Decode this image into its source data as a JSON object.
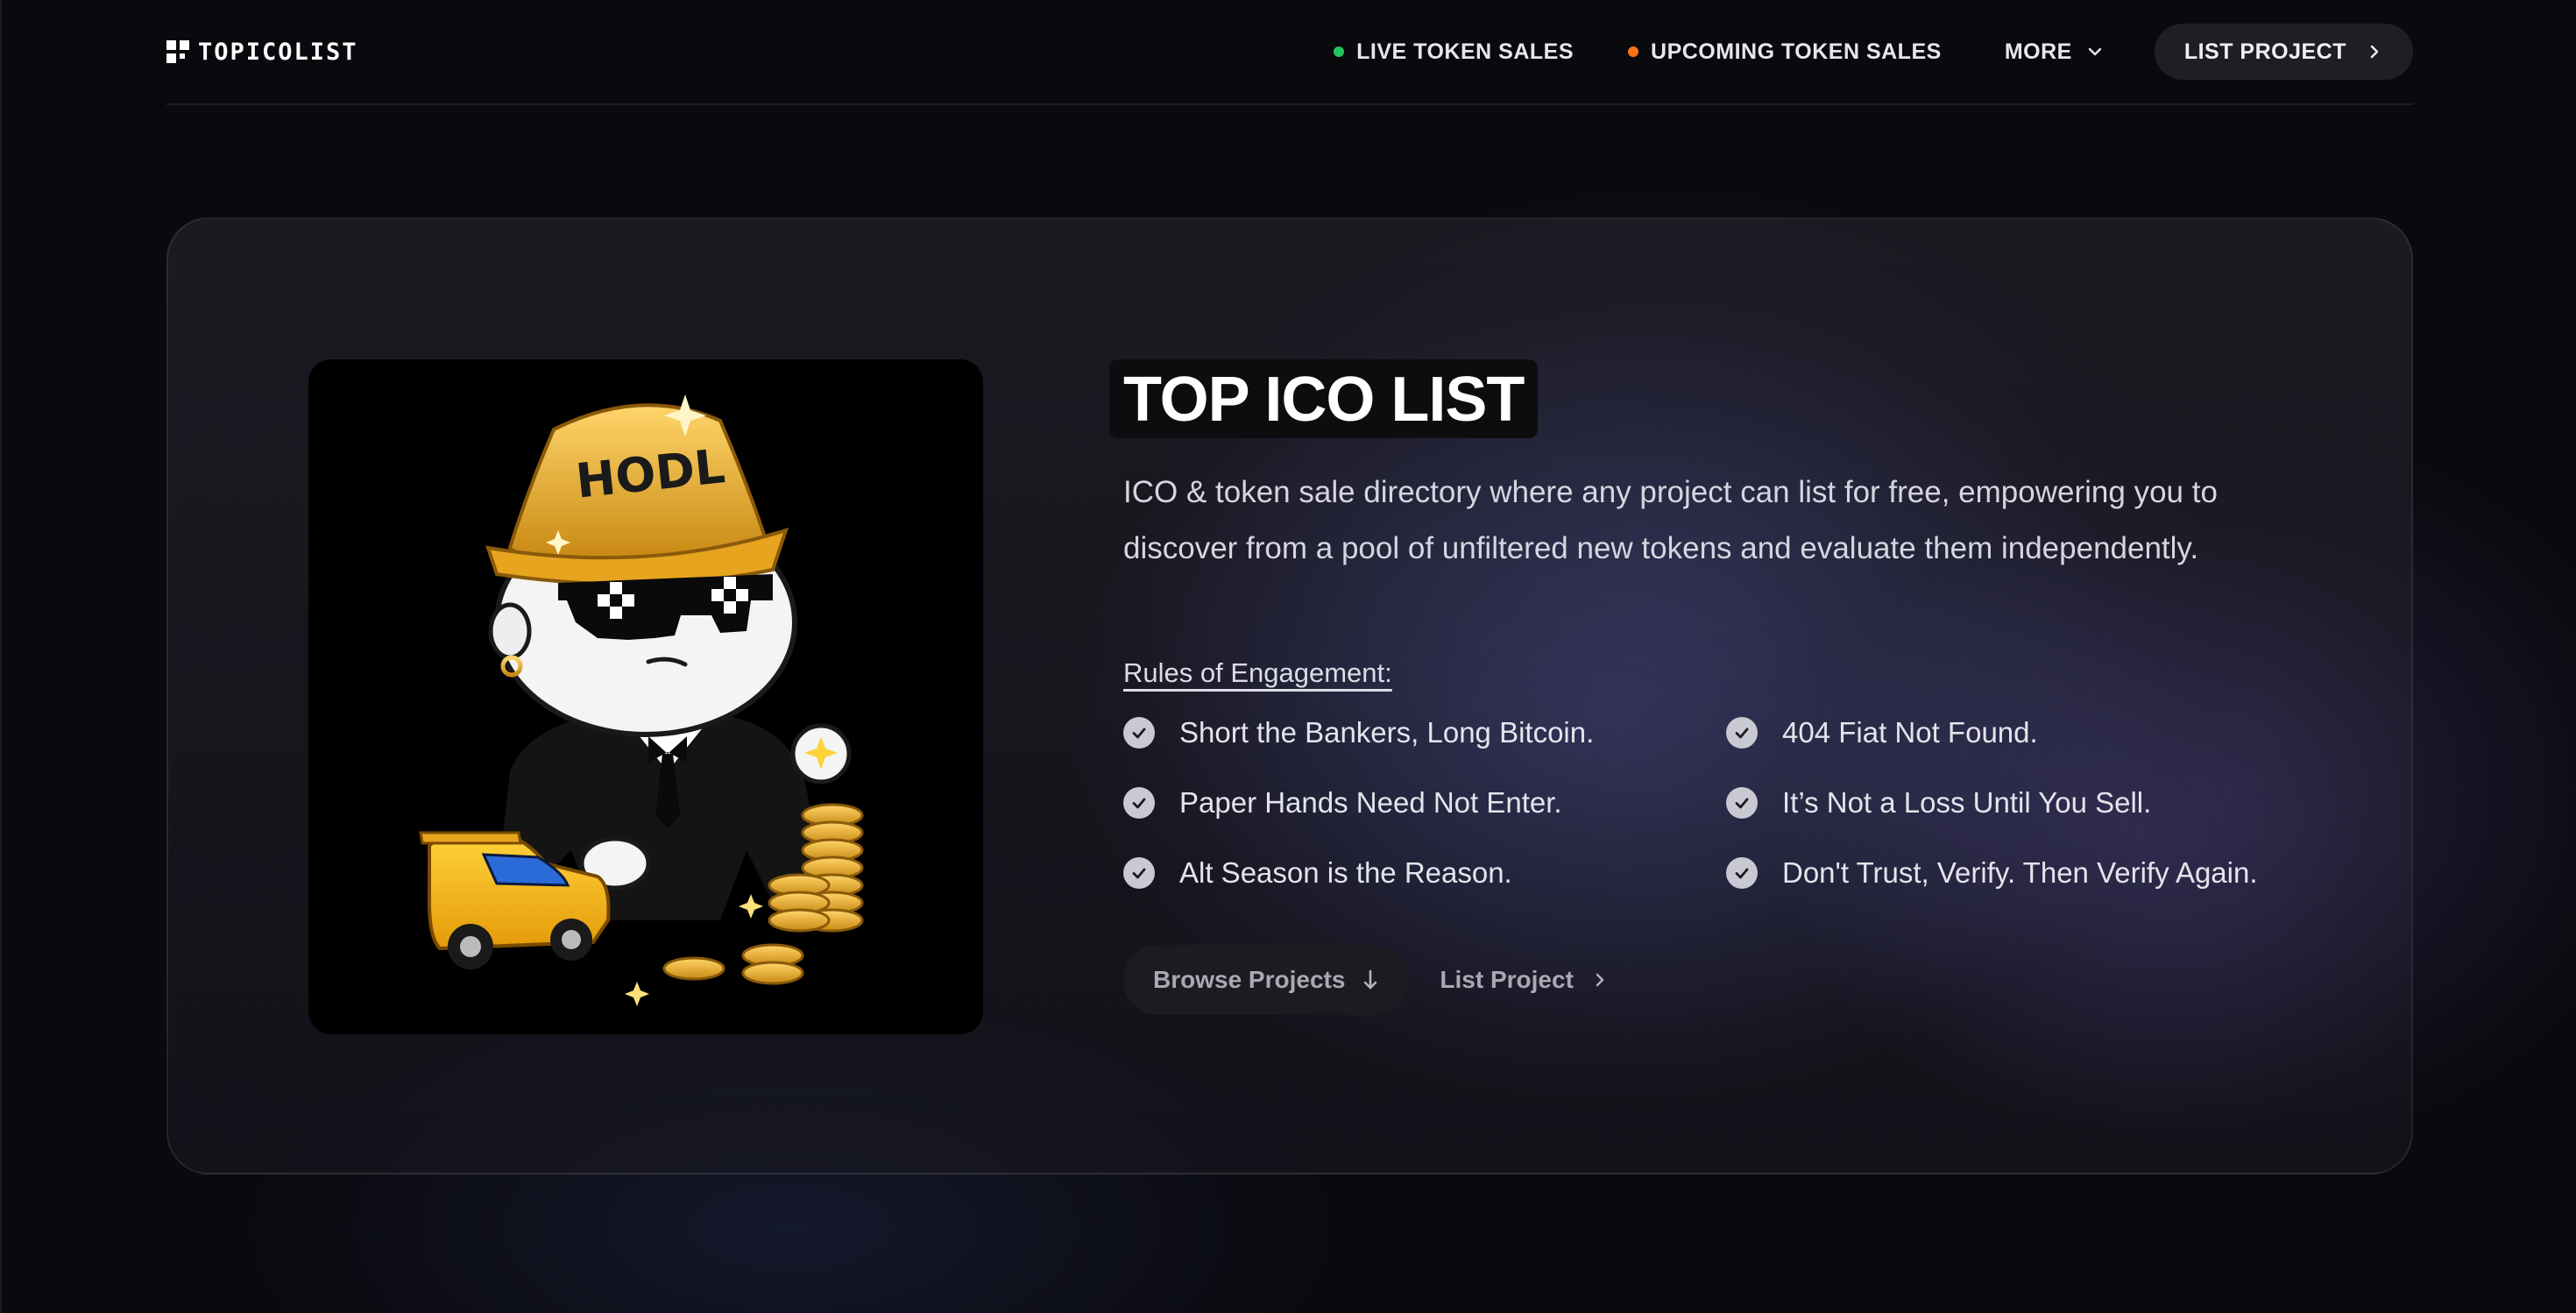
{
  "header": {
    "brand": "TOPICOLIST",
    "nav": {
      "live": {
        "label": "LIVE TOKEN SALES",
        "dot_color": "#22c55e"
      },
      "upcoming": {
        "label": "UPCOMING TOKEN SALES",
        "dot_color": "#f97316"
      },
      "more": {
        "label": "MORE"
      },
      "list_project": {
        "label": "LIST PROJECT"
      }
    }
  },
  "hero": {
    "image": {
      "hat_text": "HODL"
    },
    "title": "TOP ICO LIST",
    "description": "ICO & token sale directory where any project can list for free, empowering you to discover from a pool of unfiltered new tokens and evaluate them independently.",
    "rules_label": "Rules of Engagement:",
    "rules": [
      "Short the Bankers, Long Bitcoin.",
      "404 Fiat Not Found.",
      "Paper Hands Need Not Enter.",
      "It’s Not a Loss Until You Sell.",
      "Alt Season is the Reason.",
      "Don't Trust, Verify. Then Verify Again."
    ],
    "actions": {
      "browse": "Browse Projects",
      "list": "List Project"
    }
  },
  "colors": {
    "background": "#0a0a0e",
    "card_button": "#1e1e25",
    "gold": "#f2b431"
  }
}
